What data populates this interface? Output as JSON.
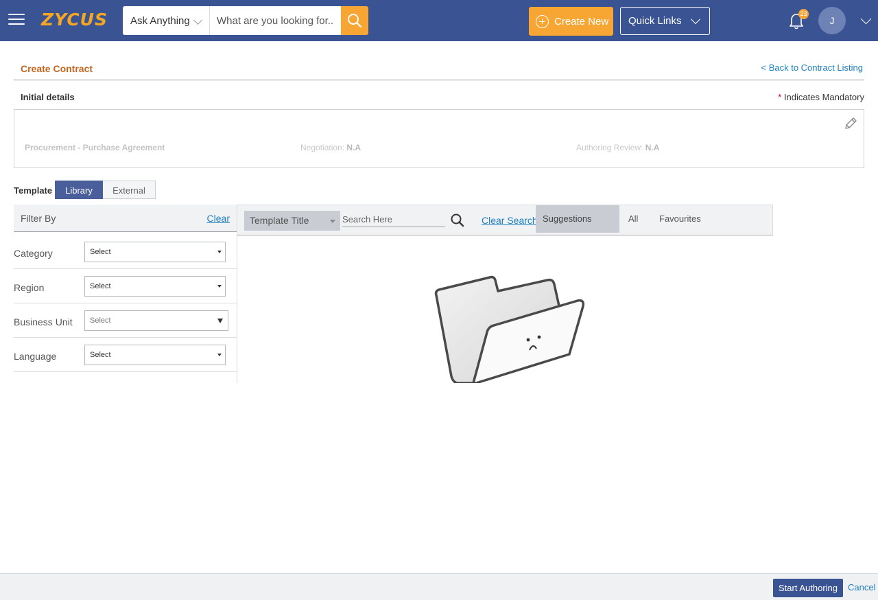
{
  "topbar": {
    "menu_icon": "hamburger-menu-icon",
    "logo_text": "ZYCUS",
    "ask_label": "Ask Anything",
    "search_placeholder": "What are you looking for...",
    "search_icon": "search-icon",
    "create_new_label": "Create New",
    "quick_links_label": "Quick Links",
    "notification_count": "23",
    "avatar_initial": "J",
    "accent_color": "#f7a533",
    "bar_color": "#3a5393"
  },
  "header": {
    "title": "Create Contract",
    "back_link": "< Back to Contract Listing",
    "section_title": "Initial details",
    "mandatory_star": "*",
    "mandatory_text": "Indicates Mandatory"
  },
  "details": {
    "type": "Procurement - Purchase Agreement",
    "negotiation_label": "Negotiation:",
    "negotiation_value": "N.A",
    "authoring_label": "Authoring Review:",
    "authoring_value": "N.A"
  },
  "template": {
    "label": "Template",
    "tabs": [
      {
        "label": "Library",
        "active": true
      },
      {
        "label": "External",
        "active": false
      }
    ]
  },
  "filters": {
    "title": "Filter By",
    "clear_label": "Clear",
    "rows": [
      {
        "label": "Category",
        "value": "Select"
      },
      {
        "label": "Region",
        "value": "Select"
      },
      {
        "label": "Business Unit",
        "value": "Select"
      },
      {
        "label": "Language",
        "value": "Select"
      }
    ]
  },
  "toolbar": {
    "field_select": "Template Title",
    "search_placeholder": "Search Here",
    "clear_search": "Clear Search",
    "segments": [
      "Suggestions",
      "All",
      "Favourites"
    ],
    "active_segment": "Suggestions"
  },
  "empty_state": {
    "icon": "empty-folder-icon"
  },
  "footer": {
    "start_label": "Start Authoring",
    "cancel_label": "Cancel"
  }
}
